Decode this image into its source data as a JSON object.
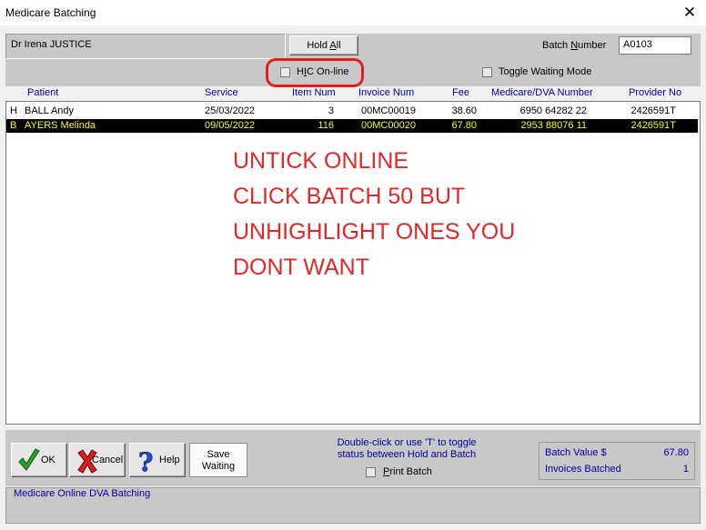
{
  "window": {
    "title": "Medicare Batching"
  },
  "header": {
    "doctor": "Dr Irena JUSTICE",
    "hold_all": "Hold All",
    "batch_number_label": "Batch Number",
    "batch_number_value": "A0103",
    "hic_online_label": "HIC On-line",
    "toggle_waiting_label": "Toggle Waiting Mode"
  },
  "columns": [
    "Patient",
    "Service",
    "Item Num",
    "Invoice Num",
    "Fee",
    "Medicare/DVA Number",
    "Provider No"
  ],
  "rows": [
    {
      "status": "H",
      "patient": "BALL Andy",
      "service": "25/03/2022",
      "item": "3",
      "invoice": "00MC00019",
      "fee": "38.60",
      "medicare": "6950 64282 22",
      "provider": "2426591T",
      "selected": false
    },
    {
      "status": "B",
      "patient": "AYERS Melinda",
      "service": "09/05/2022",
      "item": "116",
      "invoice": "00MC00020",
      "fee": "67.80",
      "medicare": "2953 88076 11",
      "provider": "2426591T",
      "selected": true
    }
  ],
  "annotation": [
    "UNTICK ONLINE",
    "CLICK BATCH 50 BUT",
    "UNHIGHLIGHT ONES YOU",
    "DONT WANT"
  ],
  "buttons": {
    "ok": "OK",
    "cancel": "Cancel",
    "help": "Help",
    "save_line1": "Save",
    "save_line2": "Waiting"
  },
  "hint": {
    "line1": "Double-click or use 'T' to toggle",
    "line2": "status between Hold and Batch"
  },
  "print_batch_label": "Print Batch",
  "summary": {
    "batch_value_label": "Batch Value $",
    "batch_value": "67.80",
    "invoices_batched_label": "Invoices Batched",
    "invoices_batched": "1"
  },
  "status_panel": "Medicare Online DVA Batching",
  "colors": {
    "annotation": "#e02828",
    "selected_row_bg": "#000000",
    "selected_row_text": "#ffff00",
    "label_blue": "#0000a0"
  }
}
